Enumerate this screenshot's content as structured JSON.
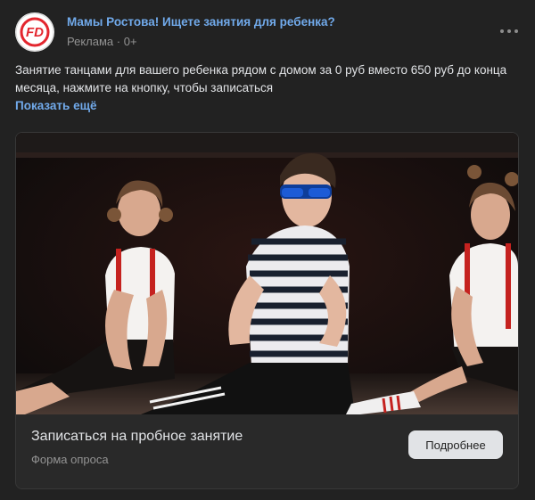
{
  "post": {
    "author": "Мамы Ростова! Ищете занятия для ребенка?",
    "ad_label": "Реклама",
    "separator": "·",
    "age_rating": "0+",
    "text": "Занятие танцами для вашего ребенка рядом с домом за 0 руб вместо 650 руб до конца месяца, нажмите на кнопку, чтобы записаться",
    "show_more": "Показать ещё",
    "more_icon": "ellipsis-icon",
    "avatar_logo": "FD"
  },
  "card": {
    "title": "Записаться на пробное занятие",
    "subtitle": "Форма опроса",
    "button_label": "Подробнее"
  },
  "colors": {
    "background": "#222222",
    "link": "#71aaeb",
    "text": "#e1e3e6",
    "muted": "#939393",
    "button_bg": "#e1e3e6",
    "logo_red": "#e3262e"
  }
}
